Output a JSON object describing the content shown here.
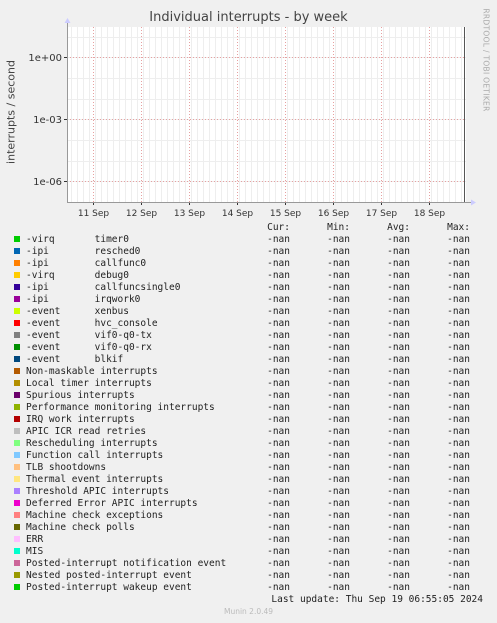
{
  "chart_data": {
    "type": "line",
    "title": "Individual interrupts - by week",
    "ylabel": "interrupts / second",
    "yscale": "log",
    "ylim": [
      1e-07,
      30
    ],
    "y_ticks": [
      {
        "value": 1,
        "label": "1e+00"
      },
      {
        "value": 0.001,
        "label": "1e-03"
      },
      {
        "value": 1e-06,
        "label": "1e-06"
      }
    ],
    "x_ticks": [
      "11 Sep",
      "12 Sep",
      "13 Sep",
      "14 Sep",
      "15 Sep",
      "16 Sep",
      "17 Sep",
      "18 Sep"
    ],
    "grid": true,
    "series_values": "nan",
    "legend_columns": [
      "Cur:",
      "Min:",
      "Avg:",
      "Max:"
    ],
    "series": [
      {
        "name": "-virq       timer0",
        "color": "#00cc00",
        "cur": "-nan",
        "min": "-nan",
        "avg": "-nan",
        "max": "-nan"
      },
      {
        "name": "-ipi        resched0",
        "color": "#0066b3",
        "cur": "-nan",
        "min": "-nan",
        "avg": "-nan",
        "max": "-nan"
      },
      {
        "name": "-ipi        callfunc0",
        "color": "#ff8000",
        "cur": "-nan",
        "min": "-nan",
        "avg": "-nan",
        "max": "-nan"
      },
      {
        "name": "-virq       debug0",
        "color": "#ffcc00",
        "cur": "-nan",
        "min": "-nan",
        "avg": "-nan",
        "max": "-nan"
      },
      {
        "name": "-ipi        callfuncsingle0",
        "color": "#330099",
        "cur": "-nan",
        "min": "-nan",
        "avg": "-nan",
        "max": "-nan"
      },
      {
        "name": "-ipi        irqwork0",
        "color": "#990099",
        "cur": "-nan",
        "min": "-nan",
        "avg": "-nan",
        "max": "-nan"
      },
      {
        "name": "-event      xenbus",
        "color": "#ccff00",
        "cur": "-nan",
        "min": "-nan",
        "avg": "-nan",
        "max": "-nan"
      },
      {
        "name": "-event      hvc_console",
        "color": "#ff0000",
        "cur": "-nan",
        "min": "-nan",
        "avg": "-nan",
        "max": "-nan"
      },
      {
        "name": "-event      vif0-q0-tx",
        "color": "#808080",
        "cur": "-nan",
        "min": "-nan",
        "avg": "-nan",
        "max": "-nan"
      },
      {
        "name": "-event      vif0-q0-rx",
        "color": "#008f00",
        "cur": "-nan",
        "min": "-nan",
        "avg": "-nan",
        "max": "-nan"
      },
      {
        "name": "-event      blkif",
        "color": "#00487d",
        "cur": "-nan",
        "min": "-nan",
        "avg": "-nan",
        "max": "-nan"
      },
      {
        "name": "Non-maskable interrupts",
        "color": "#b35a00",
        "cur": "-nan",
        "min": "-nan",
        "avg": "-nan",
        "max": "-nan"
      },
      {
        "name": "Local timer interrupts",
        "color": "#b38f00",
        "cur": "-nan",
        "min": "-nan",
        "avg": "-nan",
        "max": "-nan"
      },
      {
        "name": "Spurious interrupts",
        "color": "#6b006b",
        "cur": "-nan",
        "min": "-nan",
        "avg": "-nan",
        "max": "-nan"
      },
      {
        "name": "Performance monitoring interrupts",
        "color": "#8fb300",
        "cur": "-nan",
        "min": "-nan",
        "avg": "-nan",
        "max": "-nan"
      },
      {
        "name": "IRQ work interrupts",
        "color": "#b30000",
        "cur": "-nan",
        "min": "-nan",
        "avg": "-nan",
        "max": "-nan"
      },
      {
        "name": "APIC ICR read retries",
        "color": "#bebebe",
        "cur": "-nan",
        "min": "-nan",
        "avg": "-nan",
        "max": "-nan"
      },
      {
        "name": "Rescheduling interrupts",
        "color": "#80ff80",
        "cur": "-nan",
        "min": "-nan",
        "avg": "-nan",
        "max": "-nan"
      },
      {
        "name": "Function call interrupts",
        "color": "#80c9ff",
        "cur": "-nan",
        "min": "-nan",
        "avg": "-nan",
        "max": "-nan"
      },
      {
        "name": "TLB shootdowns",
        "color": "#ffc080",
        "cur": "-nan",
        "min": "-nan",
        "avg": "-nan",
        "max": "-nan"
      },
      {
        "name": "Thermal event interrupts",
        "color": "#ffe680",
        "cur": "-nan",
        "min": "-nan",
        "avg": "-nan",
        "max": "-nan"
      },
      {
        "name": "Threshold APIC interrupts",
        "color": "#aa80ff",
        "cur": "-nan",
        "min": "-nan",
        "avg": "-nan",
        "max": "-nan"
      },
      {
        "name": "Deferred Error APIC interrupts",
        "color": "#ee00cc",
        "cur": "-nan",
        "min": "-nan",
        "avg": "-nan",
        "max": "-nan"
      },
      {
        "name": "Machine check exceptions",
        "color": "#ff8080",
        "cur": "-nan",
        "min": "-nan",
        "avg": "-nan",
        "max": "-nan"
      },
      {
        "name": "Machine check polls",
        "color": "#666600",
        "cur": "-nan",
        "min": "-nan",
        "avg": "-nan",
        "max": "-nan"
      },
      {
        "name": "ERR",
        "color": "#ffbfff",
        "cur": "-nan",
        "min": "-nan",
        "avg": "-nan",
        "max": "-nan"
      },
      {
        "name": "MIS",
        "color": "#00ffcc",
        "cur": "-nan",
        "min": "-nan",
        "avg": "-nan",
        "max": "-nan"
      },
      {
        "name": "Posted-interrupt notification event",
        "color": "#cc6699",
        "cur": "-nan",
        "min": "-nan",
        "avg": "-nan",
        "max": "-nan"
      },
      {
        "name": "Nested posted-interrupt event",
        "color": "#999900",
        "cur": "-nan",
        "min": "-nan",
        "avg": "-nan",
        "max": "-nan"
      },
      {
        "name": "Posted-interrupt wakeup event",
        "color": "#00cc00",
        "cur": "-nan",
        "min": "-nan",
        "avg": "-nan",
        "max": "-nan"
      }
    ],
    "last_update": "Last update: Thu Sep 19 06:55:05 2024"
  },
  "watermark": "RRDTOOL / TOBI OETIKER",
  "footer": "Munin 2.0.49",
  "colors": {
    "background": "#f0f0f0",
    "plot_bg": "#ffffff",
    "grid": "#e6a0a0",
    "axis": "#333333"
  }
}
